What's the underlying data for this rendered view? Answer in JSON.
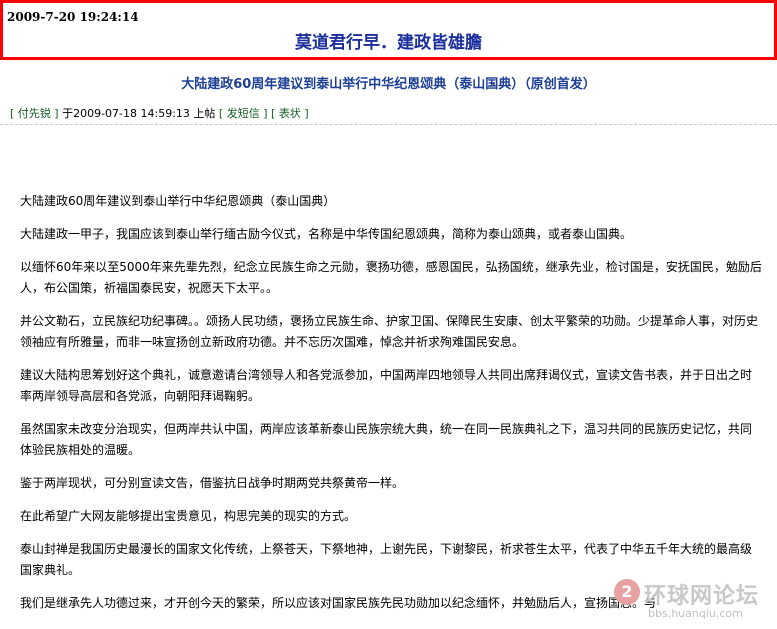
{
  "header": {
    "timestamp": "2009-7-20 19:24:14",
    "slogan": "莫道君行早．建政皆雄膽",
    "border_color": "#ff0000",
    "slogan_color": "#1b2f9c"
  },
  "post": {
    "title": "大陆建政60周年建议到泰山举行中华纪恩颂典（泰山国典）（原创首发）",
    "bracket_open": "[",
    "bracket_close": "]",
    "author": "付先锐",
    "posted_prefix": "于2009-07-18 14:59:13 上帖",
    "send_message": "发短信",
    "reply_face": "表状",
    "link_color": "#155e26",
    "title_color": "#1c3f94"
  },
  "article": {
    "paragraphs": [
      "大陆建政60周年建议到泰山举行中华纪恩颂典（泰山国典）",
      "大陆建政一甲子，我国应该到泰山举行缅古励今仪式，名称是中华传国纪恩颂典，简称为泰山颂典，或者泰山国典。",
      "以缅怀60年来以至5000年来先辈先烈，纪念立民族生命之元勋，褒扬功德，感恩国民，弘扬国统，继承先业，检讨国是，安抚国民，勉励后人，布公国策，祈福国泰民安，祝愿天下太平。。",
      "并公文勒石，立民族纪功纪事碑。。颂扬人民功绩，褒扬立民族生命、护家卫国、保障民生安康、创太平繁荣的功勋。少提革命人事，对历史领袖应有所雅量，而非一味宣扬创立新政府功德。并不忘历次国难，悼念并祈求殉难国民安息。",
      "建议大陆构思筹划好这个典礼，诚意邀请台湾领导人和各党派参加，中国两岸四地领导人共同出席拜谒仪式，宣读文告书表，并于日出之时率两岸领导高层和各党派，向朝阳拜谒鞠躬。",
      "虽然国家未改变分治现实，但两岸共认中国，两岸应该革新泰山民族宗统大典，统一在同一民族典礼之下，温习共同的民族历史记忆，共同体验民族相处的温暖。",
      "鉴于两岸现状，可分别宣读文告，借鉴抗日战争时期两党共祭黄帝一样。",
      "在此希望广大网友能够提出宝贵意见，构思完美的现实的方式。",
      "泰山封禅是我国历史最漫长的国家文化传统，上祭苍天，下祭地神，上谢先民，下谢黎民，祈求苍生太平，代表了中华五千年大统的最高级国家典礼。",
      "我们是继承先人功德过来，才开创今天的繁荣，所以应该对国家民族先民功勋加以纪念缅怀，并勉励后人，宣扬国志。与"
    ]
  },
  "watermark": {
    "badge": "2",
    "text": "环球网论坛",
    "url": "bbs.huanqiu.com"
  }
}
